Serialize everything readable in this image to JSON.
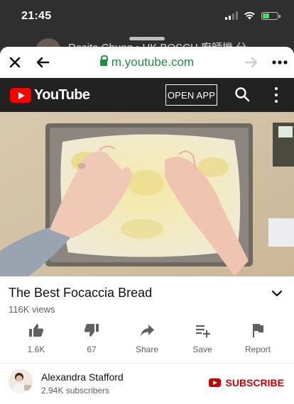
{
  "status": {
    "time": "21:45",
    "battery_level": 0.45
  },
  "background_notification": {
    "text": "Rosita Chung • HK BOSCH 廚師機 分"
  },
  "browser": {
    "url": "m.youtube.com"
  },
  "youtube_header": {
    "logo_text": "YouTube",
    "open_app_label": "OPEN APP"
  },
  "video": {
    "title": "The Best Focaccia Bread",
    "views": "116K views",
    "actions": [
      {
        "id": "like",
        "label": "1.6K",
        "icon": "thumbs-up-icon"
      },
      {
        "id": "dislike",
        "label": "67",
        "icon": "thumbs-down-icon"
      },
      {
        "id": "share",
        "label": "Share",
        "icon": "share-icon"
      },
      {
        "id": "save",
        "label": "Save",
        "icon": "playlist-add-icon"
      },
      {
        "id": "report",
        "label": "Report",
        "icon": "flag-icon"
      }
    ]
  },
  "channel": {
    "name": "Alexandra Stafford",
    "subscribers": "2.94K subscribers",
    "subscribe_label": "SUBSCRIBE"
  },
  "colors": {
    "url_green": "#1f8f3e",
    "youtube_red": "#ff0000",
    "subscribe_red": "#cc0000",
    "header_dark": "#212121"
  }
}
